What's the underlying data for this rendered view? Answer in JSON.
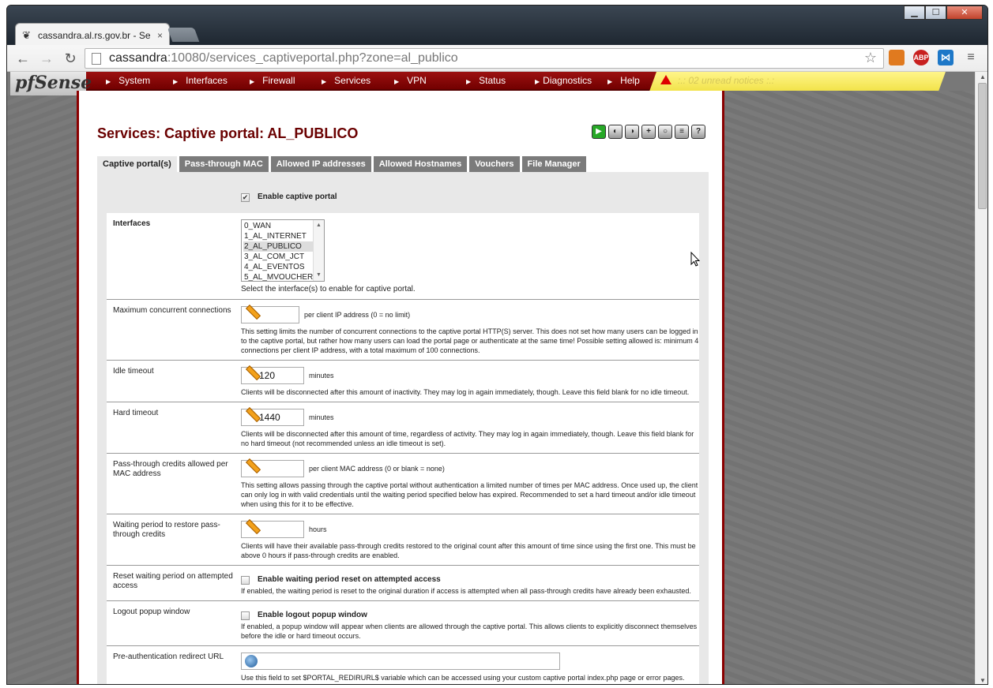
{
  "browser": {
    "tab_title": "cassandra.al.rs.gov.br - Se",
    "tab_close": "×",
    "url_host": "cassandra",
    "url_rest": ":10080/services_captiveportal.php?zone=al_publico",
    "controls": {
      "minimize": "▁",
      "maximize": "☐",
      "close": "✕"
    },
    "nav": {
      "back": "←",
      "forward": "→",
      "reload": "↻"
    },
    "star": "☆",
    "menu_icon": "≡",
    "abp_label": "ABP"
  },
  "pfsense": {
    "logo": "pfSense",
    "menu": [
      "System",
      "Interfaces",
      "Firewall",
      "Services",
      "VPN",
      "Status",
      "Diagnostics",
      "Help"
    ],
    "alert": ":.: 02 unread notices :.:"
  },
  "page": {
    "title": "Services: Captive portal: AL_PUBLICO",
    "tabs": [
      "Captive portal(s)",
      "Pass-through MAC",
      "Allowed IP addresses",
      "Allowed Hostnames",
      "Vouchers",
      "File Manager"
    ],
    "active_tab": 0
  },
  "form": {
    "enable": {
      "checked": true,
      "label": "Enable captive portal"
    },
    "interfaces": {
      "label": "Interfaces",
      "options": [
        "0_WAN",
        "1_AL_INTERNET",
        "2_AL_PUBLICO",
        "3_AL_COM_JCT",
        "4_AL_EVENTOS",
        "5_AL_MVOUCHER"
      ],
      "selected": "2_AL_PUBLICO",
      "help": "Select the interface(s) to enable for captive portal."
    },
    "max_conn": {
      "label": "Maximum concurrent connections",
      "value": "",
      "unit": "per client IP address (0 = no limit)",
      "help": "This setting limits the number of concurrent connections to the captive portal HTTP(S) server. This does not set how many users can be logged in to the captive portal, but rather how many users can load the portal page or authenticate at the same time! Possible setting allowed is: minimum 4 connections per client IP address, with a total maximum of 100 connections."
    },
    "idle_timeout": {
      "label": "Idle timeout",
      "value": "120",
      "unit": "minutes",
      "help": "Clients will be disconnected after this amount of inactivity. They may log in again immediately, though. Leave this field blank for no idle timeout."
    },
    "hard_timeout": {
      "label": "Hard timeout",
      "value": "1440",
      "unit": "minutes",
      "help": "Clients will be disconnected after this amount of time, regardless of activity. They may log in again immediately, though. Leave this field blank for no hard timeout (not recommended unless an idle timeout is set)."
    },
    "passthru_credits": {
      "label": "Pass-through credits allowed per MAC address",
      "value": "",
      "unit": "per client MAC address (0 or blank = none)",
      "help": "This setting allows passing through the captive portal without authentication a limited number of times per MAC address. Once used up, the client can only log in with valid credentials until the waiting period specified below has expired. Recommended to set a hard timeout and/or idle timeout when using this for it to be effective."
    },
    "waiting_period": {
      "label": "Waiting period to restore pass-through credits",
      "value": "",
      "unit": "hours",
      "help": "Clients will have their available pass-through credits restored to the original count after this amount of time since using the first one. This must be above 0 hours if pass-through credits are enabled."
    },
    "reset_waiting": {
      "label": "Reset waiting period on attempted access",
      "checked": false,
      "check_label": "Enable waiting period reset on attempted access",
      "help": "If enabled, the waiting period is reset to the original duration if access is attempted when all pass-through credits have already been exhausted."
    },
    "logout_popup": {
      "label": "Logout popup window",
      "checked": false,
      "check_label": "Enable logout popup window",
      "help": "If enabled, a popup window will appear when clients are allowed through the captive portal. This allows clients to explicitly disconnect themselves before the idle or hard timeout occurs."
    },
    "preauth_url": {
      "label": "Pre-authentication redirect URL",
      "value": "",
      "help": "Use this field to set $PORTAL_REDIRURL$ variable which can be accessed using your custom captive portal index.php page or error pages."
    }
  },
  "colors": {
    "nav_red": "#8b0000",
    "alert_yellow": "#f2e34a",
    "title_red": "#6a0000"
  }
}
